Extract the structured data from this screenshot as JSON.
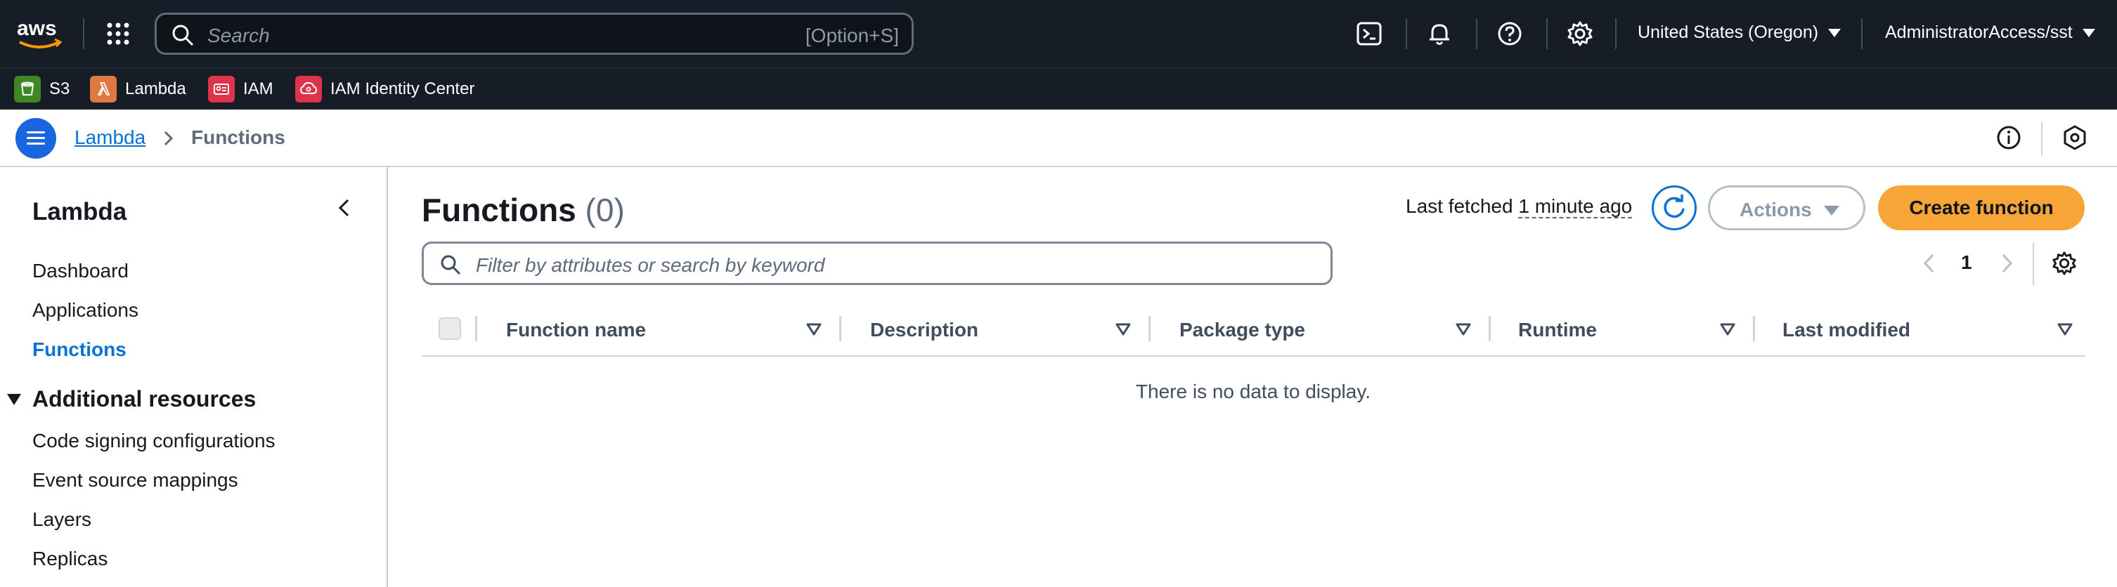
{
  "topnav": {
    "search_placeholder": "Search",
    "search_shortcut": "[Option+S]",
    "region": "United States (Oregon)",
    "account": "AdministratorAccess/sst",
    "icons": [
      "cloudshell-icon",
      "bell-icon",
      "help-icon",
      "settings-icon"
    ]
  },
  "favorites": [
    {
      "label": "S3",
      "color": "#3f8624"
    },
    {
      "label": "Lambda",
      "color": "#e07941"
    },
    {
      "label": "IAM",
      "color": "#dd344c"
    },
    {
      "label": "IAM Identity Center",
      "color": "#dd344c"
    }
  ],
  "breadcrumb": {
    "parent": "Lambda",
    "current": "Functions"
  },
  "sidenav": {
    "title": "Lambda",
    "items": [
      "Dashboard",
      "Applications",
      "Functions"
    ],
    "active": "Functions",
    "section_title": "Additional resources",
    "section_items": [
      "Code signing configurations",
      "Event source mappings",
      "Layers",
      "Replicas"
    ]
  },
  "main": {
    "title": "Functions",
    "count": "(0)",
    "last_fetched_label": "Last fetched",
    "last_fetched_value": "1 minute ago",
    "actions_label": "Actions",
    "create_label": "Create function",
    "filter_placeholder": "Filter by attributes or search by keyword",
    "page_number": "1",
    "columns": [
      "Function name",
      "Description",
      "Package type",
      "Runtime",
      "Last modified"
    ],
    "empty_message": "There is no data to display."
  },
  "colors": {
    "nav_bg": "#161d26",
    "link": "#0972d3",
    "primary_button": "#f7a536",
    "menu_button": "#1a66e0"
  }
}
